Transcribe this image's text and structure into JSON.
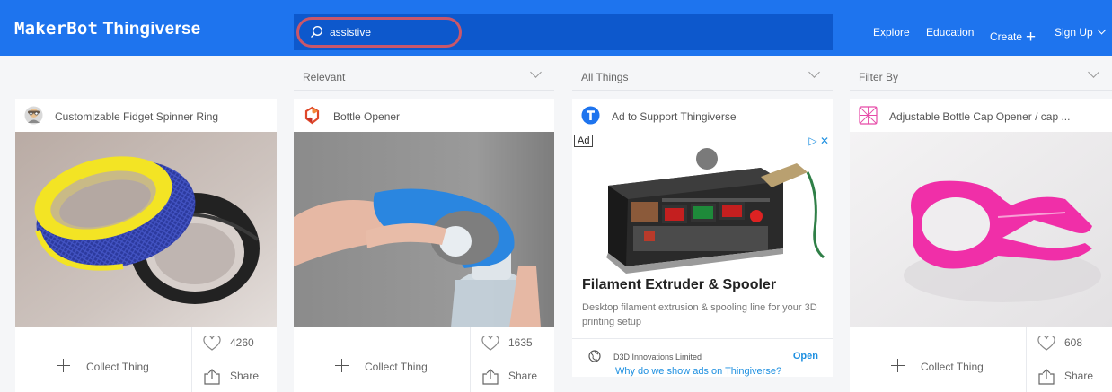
{
  "header": {
    "logo_brand": "MakerBot",
    "logo_product": "Thingiverse",
    "search_value": "assistive",
    "nav": {
      "explore": "Explore",
      "education": "Education",
      "create": "Create",
      "create_icon": "plus-icon",
      "signup": "Sign Up"
    }
  },
  "filters": {
    "sort": "Relevant",
    "type": "All Things",
    "filter_by": "Filter By"
  },
  "cards": [
    {
      "title": "Customizable Fidget Spinner Ring",
      "collect_label": "Collect Thing",
      "likes": "4260",
      "share_label": "Share"
    },
    {
      "title": "Bottle Opener",
      "collect_label": "Collect Thing",
      "likes": "1635",
      "share_label": "Share"
    },
    {
      "title": "Adjustable Bottle Cap Opener / cap ...",
      "collect_label": "Collect Thing",
      "likes": "608",
      "share_label": "Share"
    }
  ],
  "ad": {
    "title": "Ad to Support Thingiverse",
    "badge": "Ad",
    "headline": "Filament Extruder & Spooler",
    "description": "Desktop filament extrusion & spooling line for your 3D printing setup",
    "advertiser": "D3D Innovations Limited",
    "open_label": "Open",
    "why_label": "Why do we show ads on Thingiverse?"
  },
  "colors": {
    "header_bg": "#1e74ee",
    "search_bg": "#0d58cc",
    "search_highlight": "#c9576a",
    "link_blue": "#1d8fe0",
    "magenta": "#f02fa8"
  }
}
